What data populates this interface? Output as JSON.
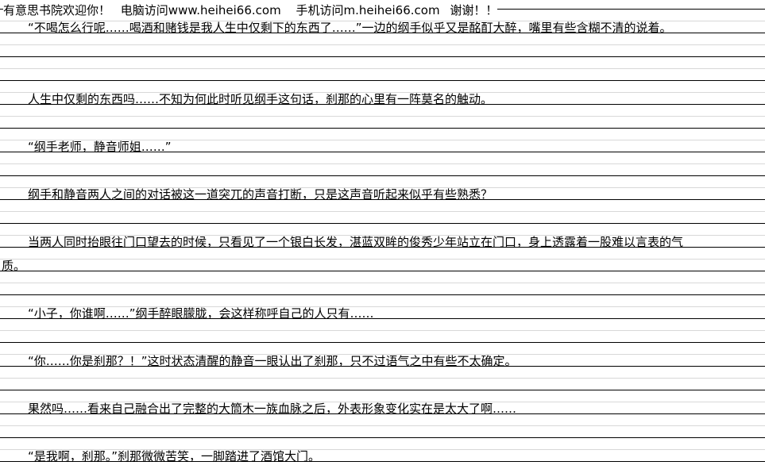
{
  "header": {
    "welcome": "有意思书院欢迎你！",
    "pc_access": "电脑访问www.heihei66.com",
    "mobile_access": "手机访问m.heihei66.com",
    "thanks": "谢谢！！"
  },
  "paragraphs": [
    "“不喝怎么行呢……喝酒和赌钱是我人生中仅剩下的东西了……”一边的纲手似乎又是酩酊大醉，嘴里有些含糊不清的说着。",
    "人生中仅剩的东西吗……不知为何此时听见纲手这句话，刹那的心里有一阵莫名的触动。",
    "“纲手老师，静音师姐……”",
    "纲手和静音两人之间的对话被这一道突兀的声音打断，只是这声音听起来似乎有些熟悉？",
    "当两人同时抬眼往门口望去的时候，只看见了一个银白长发，湛蓝双眸的俊秀少年站立在门口，身上透露着一股难以言表的气",
    "质。",
    "“小子，你谁啊……”纲手醉眼朦胧，会这样称呼自己的人只有……",
    "“你……你是刹那？！”这时状态清醒的静音一眼认出了刹那，只不过语气之中有些不太确定。",
    "果然吗……看来自己融合出了完整的大筒木一族血脉之后，外表形象变化实在是太大了啊……",
    "“是我啊，刹那。”刹那微微苦笑，一脚踏进了酒馆大门。"
  ]
}
